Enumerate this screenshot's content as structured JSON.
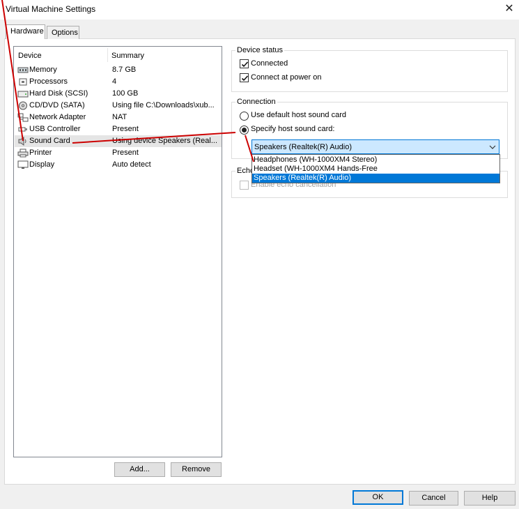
{
  "window": {
    "title": "Virtual Machine Settings",
    "close_glyph": "✕"
  },
  "tabs": [
    {
      "label": "Hardware",
      "active": true
    },
    {
      "label": "Options",
      "active": false
    }
  ],
  "device_list": {
    "columns": [
      "Device",
      "Summary"
    ],
    "rows": [
      {
        "device": "Memory",
        "summary": "8.7 GB",
        "icon": "memory-icon"
      },
      {
        "device": "Processors",
        "summary": "4",
        "icon": "processor-icon"
      },
      {
        "device": "Hard Disk (SCSI)",
        "summary": "100 GB",
        "icon": "hard-disk-icon"
      },
      {
        "device": "CD/DVD (SATA)",
        "summary": "Using file C:\\Downloads\\xub...",
        "icon": "cd-dvd-icon"
      },
      {
        "device": "Network Adapter",
        "summary": "NAT",
        "icon": "network-adapter-icon"
      },
      {
        "device": "USB Controller",
        "summary": "Present",
        "icon": "usb-icon"
      },
      {
        "device": "Sound Card",
        "summary": "Using device Speakers (Real...",
        "icon": "speaker-icon",
        "selected": true
      },
      {
        "device": "Printer",
        "summary": "Present",
        "icon": "printer-icon"
      },
      {
        "device": "Display",
        "summary": "Auto detect",
        "icon": "display-icon"
      }
    ]
  },
  "list_buttons": {
    "add": "Add...",
    "remove": "Remove"
  },
  "device_status": {
    "legend": "Device status",
    "connected": {
      "label": "Connected",
      "checked": true
    },
    "connect_at_power_on": {
      "label": "Connect at power on",
      "checked": true
    }
  },
  "connection": {
    "legend": "Connection",
    "use_default": {
      "label": "Use default host sound card",
      "selected": false
    },
    "specify": {
      "label": "Specify host sound card:",
      "selected": true
    },
    "combo_value": "Speakers (Realtek(R) Audio)",
    "options": [
      "Headphones (WH-1000XM4 Stereo)",
      "Headset (WH-1000XM4 Hands-Free",
      "Speakers (Realtek(R) Audio)"
    ],
    "selected_option": 2
  },
  "echo": {
    "legend": "Echo",
    "cancellation": {
      "label": "Enable echo cancellation",
      "checked": false,
      "enabled": false
    }
  },
  "footer_buttons": {
    "ok": "OK",
    "cancel": "Cancel",
    "help": "Help"
  },
  "colors": {
    "accent": "#0078d7",
    "annotation": "#cc0000",
    "selected_row": "#e5e5e5"
  }
}
